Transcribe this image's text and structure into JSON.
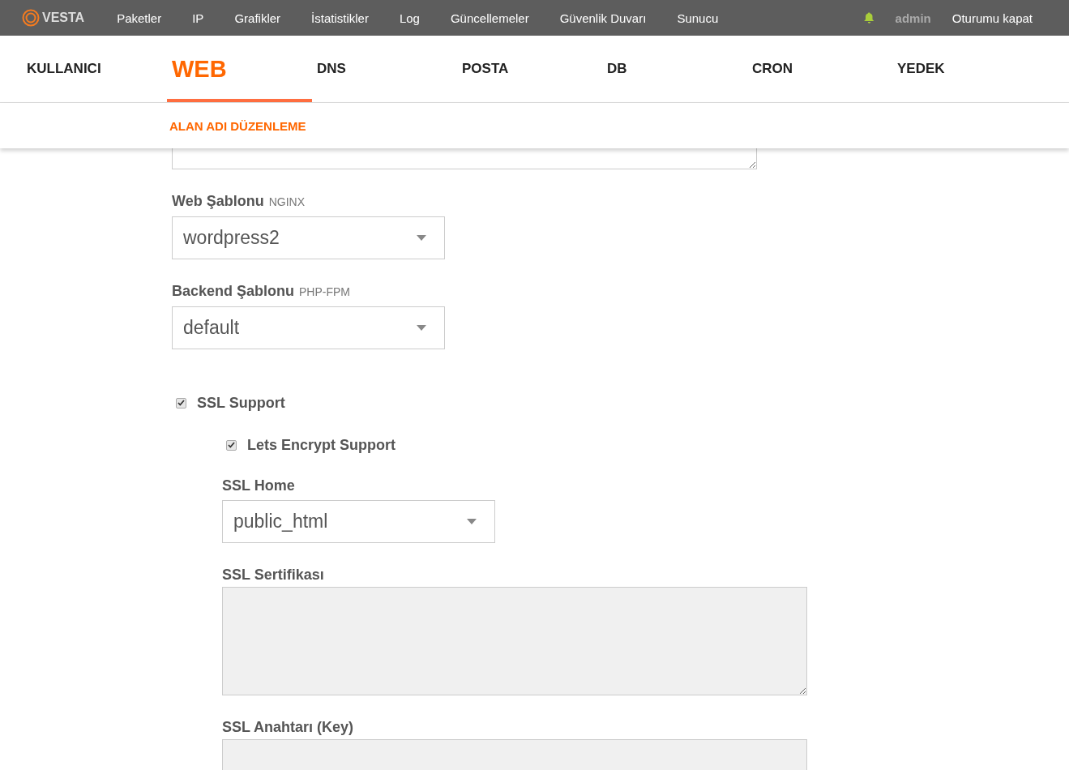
{
  "topbar": {
    "logo_text": "VESTA",
    "nav": [
      {
        "label": "Paketler"
      },
      {
        "label": "IP"
      },
      {
        "label": "Grafikler"
      },
      {
        "label": "İstatistikler"
      },
      {
        "label": "Log"
      },
      {
        "label": "Güncellemeler"
      },
      {
        "label": "Güvenlik Duvarı"
      },
      {
        "label": "Sunucu"
      }
    ],
    "user": "admin",
    "logout": "Oturumu kapat"
  },
  "tabs": [
    {
      "label": "KULLANICI",
      "selected": false
    },
    {
      "label": "WEB",
      "selected": true
    },
    {
      "label": "DNS",
      "selected": false
    },
    {
      "label": "POSTA",
      "selected": false
    },
    {
      "label": "DB",
      "selected": false
    },
    {
      "label": "CRON",
      "selected": false
    },
    {
      "label": "YEDEK",
      "selected": false
    }
  ],
  "subnav": {
    "label": "ALAN ADI DÜZENLEME"
  },
  "form": {
    "fields": [
      {
        "kind": "textarea",
        "disabled": false
      },
      {
        "kind": "select",
        "label": "Web Şablonu",
        "hint": "NGINX",
        "value": "wordpress2"
      },
      {
        "kind": "select",
        "label": "Backend Şablonu",
        "hint": "PHP-FPM",
        "value": "default"
      },
      {
        "kind": "checkbox",
        "label": "SSL Support",
        "checked": true,
        "children": [
          {
            "kind": "checkbox",
            "label": "Lets Encrypt Support",
            "checked": true
          },
          {
            "kind": "select",
            "label": "SSL Home",
            "value": "public_html"
          },
          {
            "kind": "textarea",
            "label": "SSL Sertifikası",
            "disabled": true
          },
          {
            "kind": "textarea",
            "label": "SSL Anahtarı (Key)",
            "disabled": true
          }
        ]
      }
    ]
  }
}
